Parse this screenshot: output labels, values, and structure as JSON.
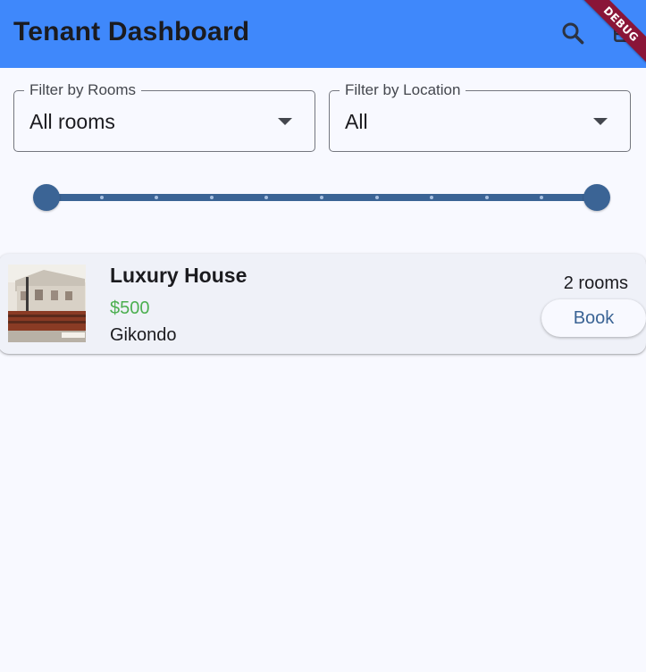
{
  "app_bar": {
    "title": "Tenant Dashboard",
    "background": "#3f88fb",
    "actions": [
      {
        "icon": "search-icon"
      },
      {
        "icon": "partially-hidden-action-icon"
      }
    ]
  },
  "debug_banner": {
    "label": "DEBUG",
    "color": "#8a1538"
  },
  "filters": {
    "rooms": {
      "label": "Filter by Rooms",
      "value": "All rooms",
      "icon": "chevron-down-icon"
    },
    "location": {
      "label": "Filter by Location",
      "value": "All",
      "icon": "chevron-down-icon"
    }
  },
  "price_range": {
    "type": "range-slider",
    "lower_fraction": 0,
    "upper_fraction": 1,
    "divisions": 10,
    "color": "#3b6495"
  },
  "listings": [
    {
      "title": "Luxury House",
      "price": "$500",
      "location": "Gikondo",
      "rooms": "2 rooms",
      "image_icon": "house-photo",
      "book_label": "Book",
      "price_color": "#4caf50"
    }
  ]
}
